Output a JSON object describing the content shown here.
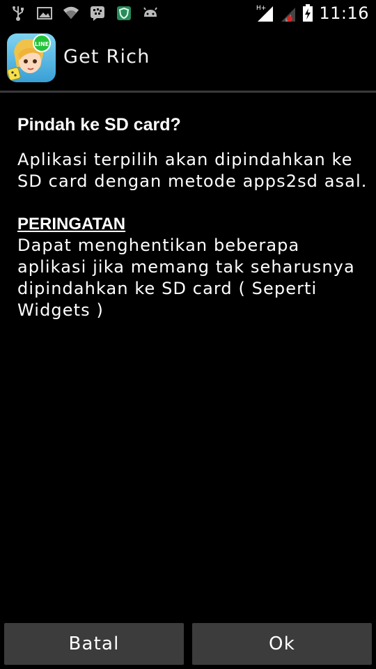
{
  "status_bar": {
    "left_icons": [
      "usb-icon",
      "image-icon",
      "wifi-icon",
      "bbm-icon",
      "shield-app-icon",
      "android-icon"
    ],
    "network_type": "H+",
    "time": "11:16"
  },
  "header": {
    "app_title": "Get Rich",
    "app_icon_badge": "LINE"
  },
  "dialog": {
    "question": "Pindah ke SD card?",
    "message": "Aplikasi terpilih akan dipindahkan ke SD card dengan metode apps2sd asal.",
    "warning_title": "PERINGATAN",
    "warning_body": "Dapat menghentikan beberapa aplikasi jika memang tak seharusnya dipindahkan ke SD card ( Seperti Widgets )"
  },
  "buttons": {
    "cancel_label": "Batal",
    "ok_label": "Ok"
  },
  "colors": {
    "background": "#000000",
    "button_bg": "#3c3c3c",
    "text": "#ffffff",
    "divider": "#3a3a3a"
  }
}
